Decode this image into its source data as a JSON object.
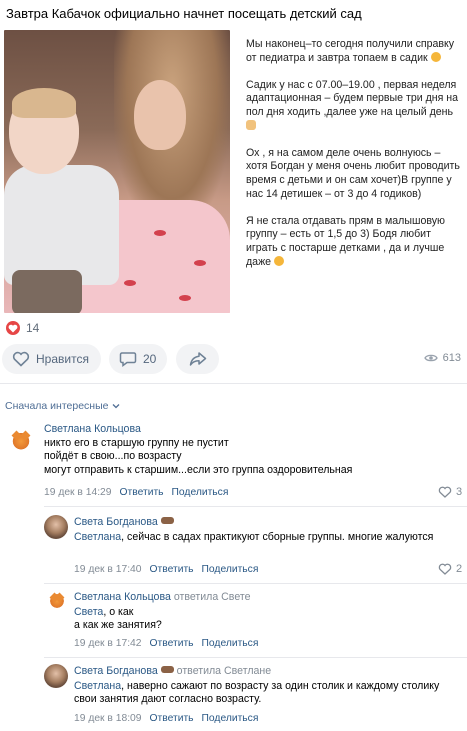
{
  "post": {
    "title": "Завтра Кабачок официально начнет посещать детский сад",
    "paragraphs": [
      "Мы наконец–то сегодня получили справку от педиатра и завтра топаем в садик",
      "Садик у нас с 07.00–19.00 , первая неделя адаптационная – будем первые три дня на пол дня ходить ,далее уже на целый день",
      "Ох , я на самом деле очень волнуюсь – хотя Богдан у меня очень любит проводить время с детьми и он сам хочет)В группе у нас 14 детишек – от 3 до 4 годиков)",
      "Я не стала отдавать прям в малышовую группу – есть от 1,5 до 3) Бодя любит играть с постарше детками , да и лучше даже"
    ],
    "likes": "14",
    "like_label": "Нравится",
    "comments_count": "20",
    "views": "613",
    "heart_color": "#e64646"
  },
  "sort_label": "Сначала интересные",
  "actions": {
    "reply": "Ответить",
    "share": "Поделиться"
  },
  "comments": [
    {
      "author": "Светлана Кольцова",
      "reply_to": "",
      "text": "никто его в старшую группу не пустит\nпойдёт в свою...по возрасту\nмогут отправить к старшим...если это группа оздоровительная",
      "mention": "",
      "date": "19 дек в 14:29",
      "likes": "3"
    },
    {
      "author": "Света Богданова",
      "reply_to": "",
      "mention": "Светлана",
      "text": ", сейчас в садах практикуют сборные группы. многие жалуются",
      "date": "19 дек в 17:40",
      "likes": "2"
    },
    {
      "author": "Светлана Кольцова",
      "reply_to": "ответила Свете",
      "mention": "Света",
      "text": ", о как\nа как же занятия?",
      "date": "19 дек в 17:42",
      "likes": ""
    },
    {
      "author": "Света Богданова",
      "reply_to": "ответила Светлане",
      "mention": "Светлана",
      "text": ", наверно сажают по возрасту за один столик и каждому столику свои занятия дают согласно возрасту.",
      "date": "19 дек в 18:09",
      "likes": ""
    }
  ]
}
